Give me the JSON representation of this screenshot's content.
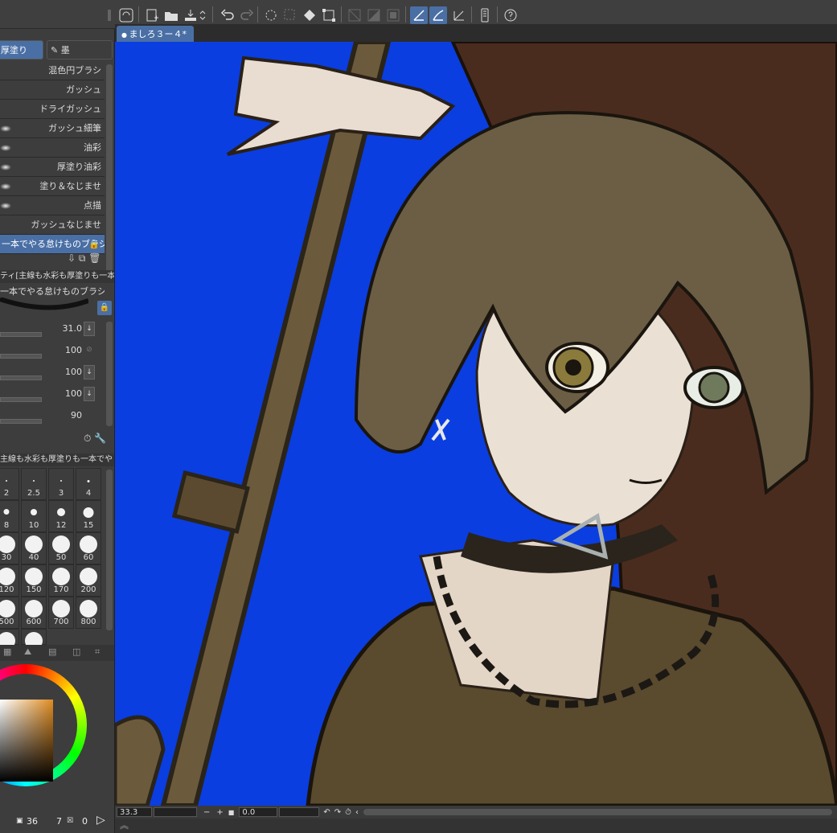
{
  "document": {
    "tab_title": "ましろ３ー４*"
  },
  "brush_tabs": [
    "厚塗り",
    "墨"
  ],
  "brushes": [
    {
      "label": "混色円ブラシ"
    },
    {
      "label": "ガッシュ"
    },
    {
      "label": "ドライガッシュ"
    },
    {
      "label": "ガッシュ細筆"
    },
    {
      "label": "油彩"
    },
    {
      "label": "厚塗り油彩"
    },
    {
      "label": "塗り＆なじませ"
    },
    {
      "label": "点描"
    },
    {
      "label": "ガッシュなじませ"
    },
    {
      "label": "一本でやる怠けものブラシ"
    }
  ],
  "tool_property": {
    "header": "ティ[主線も水彩も厚塗りも一本",
    "brush_name": "一本でやる怠けものブラシ",
    "rows": [
      {
        "value": "31.0"
      },
      {
        "value": "100"
      },
      {
        "value": "100"
      },
      {
        "value": "100"
      },
      {
        "value": "90"
      }
    ]
  },
  "size_panel": {
    "header": "主線も水彩も厚塗りも一本でや",
    "sizes": [
      "2",
      "2.5",
      "3",
      "4",
      "8",
      "10",
      "12",
      "15",
      "30",
      "40",
      "50",
      "60",
      "120",
      "150",
      "170",
      "200",
      "500",
      "600",
      "700",
      "800"
    ]
  },
  "color": {
    "main": "#e08d22",
    "count_a": "36",
    "count_b": "7",
    "count_c": "0"
  },
  "status": {
    "zoom": "33.3",
    "angle": "0.0"
  },
  "colors": {
    "canvas_bg": "#0a3ee0",
    "accent": "#4a6fa5",
    "panel": "#3d3d3d"
  }
}
